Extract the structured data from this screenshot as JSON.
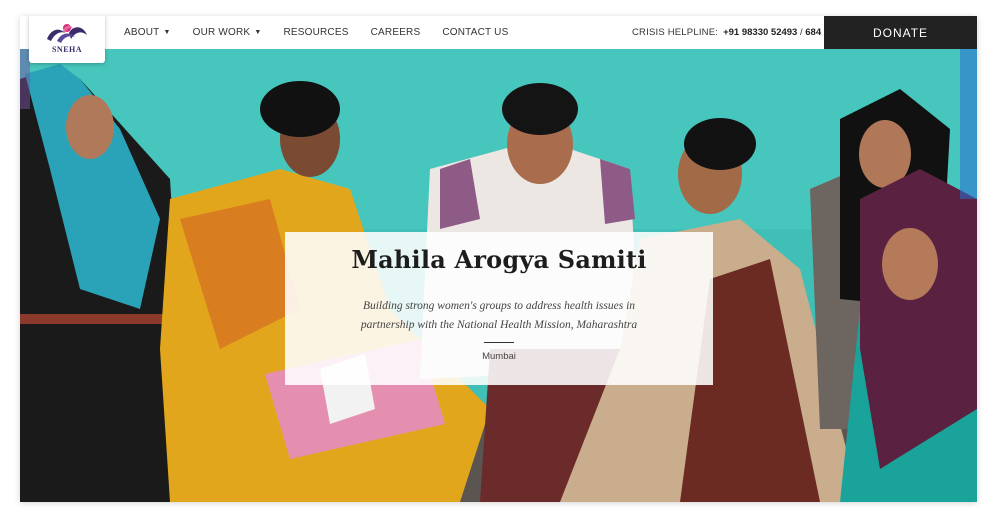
{
  "header": {
    "logo_text": "SNEHA",
    "nav": [
      {
        "label": "ABOUT",
        "has_dropdown": true
      },
      {
        "label": "OUR WORK",
        "has_dropdown": true
      },
      {
        "label": "RESOURCES",
        "has_dropdown": false
      },
      {
        "label": "CAREERS",
        "has_dropdown": false
      },
      {
        "label": "CONTACT US",
        "has_dropdown": false
      }
    ],
    "helpline_label": "CRISIS HELPLINE:",
    "helpline_number": "+91 98330 52493",
    "helpline_sep": " / ",
    "helpline_ext": "684",
    "donate_label": "DONATE"
  },
  "hero": {
    "title": "Mahila Arogya Samiti",
    "subtitle": "Building strong women's groups to address health issues in partnership with the National Health Mission, Maharashtra",
    "location": "Mumbai"
  },
  "colors": {
    "wall": "#3fbfb6",
    "donate_bg": "#222222",
    "logo_purple": "#3a2b6b",
    "logo_pink": "#d7357a"
  },
  "icons": {
    "logo": "sneha-bird-logo",
    "caret": "chevron-down-icon"
  }
}
